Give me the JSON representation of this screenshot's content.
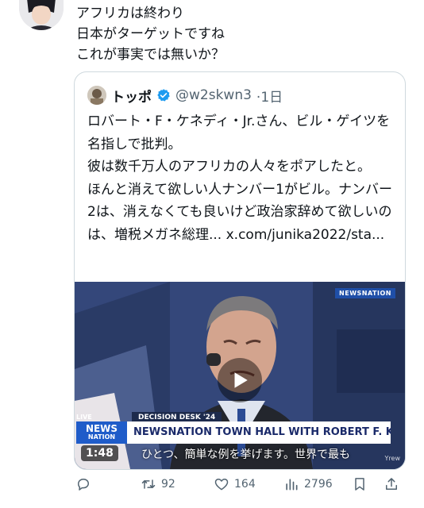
{
  "post": {
    "text": "アフリカは終わり\n日本がターゲットですね\nこれが事実では無いか？"
  },
  "quote": {
    "name": "トッポ",
    "handle": "@w2skwn3",
    "time": "·1日",
    "text": "ロバート・F・ケネディ・Jr.さん、ビル・ゲイツを名指しで批判。\n彼は数千万人のアフリカの人々をポアしたと。\nほんと消えて欲しい人ナンバー1がビル。ナンバー2は、消えなくても良いけど政治家辞めて欲しいのは、増税メガネ総理... x.com/junika2022/sta..."
  },
  "video": {
    "duration": "1:48",
    "corner_logo": "NEWSNATION",
    "desk_label": "DECISION DESK '24",
    "live_tag": "LIVE",
    "logo_line1": "NEWS",
    "logo_line2": "NATION",
    "banner": "NEWSNATION TOWN HALL WITH ROBERT F. KENNEDY JR.",
    "subtitle": "ひとつ、簡単な例を挙げます。世界で最も",
    "watermark": "Yrew"
  },
  "actions": {
    "reply": "",
    "retweet": "92",
    "like": "164",
    "views": "2796"
  },
  "colors": {
    "verified": "#1d9bf0",
    "muted": "#536471",
    "border": "#cfd9de"
  }
}
